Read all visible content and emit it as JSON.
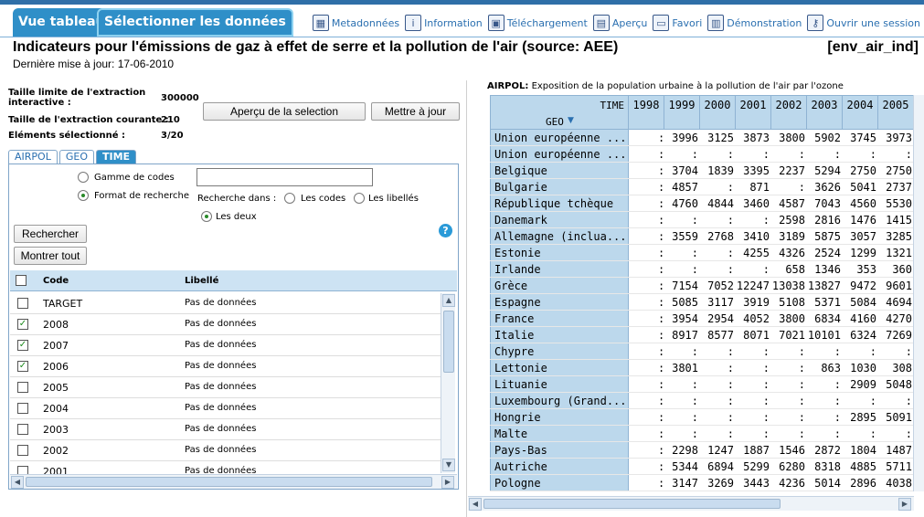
{
  "header": {
    "tabs": [
      "Vue tableau",
      "Sélectionner les données"
    ],
    "toolbar": [
      {
        "label": "Metadonnées",
        "icon": "metadata-icon"
      },
      {
        "label": "Information",
        "icon": "info-icon"
      },
      {
        "label": "Téléchargement",
        "icon": "save-icon"
      },
      {
        "label": "Aperçu",
        "icon": "print-icon"
      },
      {
        "label": "Favori",
        "icon": "folder-icon"
      },
      {
        "label": "Démonstration",
        "icon": "film-icon"
      },
      {
        "label": "Ouvrir une session",
        "icon": "key-icon"
      }
    ]
  },
  "page": {
    "title": "Indicateurs pour l'émissions de gaz à effet de serre et la pollution de l'air (source: AEE)",
    "code": "[env_air_ind]",
    "updated": "Dernière mise à jour: 17-06-2010"
  },
  "left": {
    "limit_label": "Taille limite de l'extraction interactive :",
    "limit_value": "300000",
    "current_label": "Taille de l'extraction courante :",
    "current_value": "210",
    "selected_label": "Eléments sélectionné :",
    "selected_value": "3/20",
    "preview_button": "Aperçu de la selection",
    "update_button": "Mettre à jour",
    "subtabs": [
      "AIRPOL",
      "GEO",
      "TIME"
    ],
    "radio_range": "Gamme de codes",
    "radio_format": "Format de recherche",
    "search_in": "Recherche dans :",
    "opt_codes": "Les codes",
    "opt_labels": "Les libellés",
    "opt_both": "Les deux",
    "search_button": "Rechercher",
    "show_all_button": "Montrer tout",
    "help": "?",
    "col_code": "Code",
    "col_label": "Libellé",
    "rows": [
      {
        "code": "TARGET",
        "label": "Pas de données",
        "checked": false
      },
      {
        "code": "2008",
        "label": "Pas de données",
        "checked": true
      },
      {
        "code": "2007",
        "label": "Pas de données",
        "checked": true
      },
      {
        "code": "2006",
        "label": "Pas de données",
        "checked": true
      },
      {
        "code": "2005",
        "label": "Pas de données",
        "checked": false
      },
      {
        "code": "2004",
        "label": "Pas de données",
        "checked": false
      },
      {
        "code": "2003",
        "label": "Pas de données",
        "checked": false
      },
      {
        "code": "2002",
        "label": "Pas de données",
        "checked": false
      },
      {
        "code": "2001",
        "label": "Pas de données",
        "checked": false
      }
    ]
  },
  "right": {
    "caption_code": "AIRPOL:",
    "caption_text": "Exposition de la population urbaine à la pollution de l'air par l'ozone",
    "time_label": "TIME",
    "geo_label": "GEO",
    "years": [
      "1998",
      "1999",
      "2000",
      "2001",
      "2002",
      "2003",
      "2004",
      "2005"
    ],
    "rows": [
      {
        "geo": "Union européenne ...",
        "vals": [
          ":",
          "3996",
          "3125",
          "3873",
          "3800",
          "5902",
          "3745",
          "3973"
        ]
      },
      {
        "geo": "Union européenne ...",
        "vals": [
          ":",
          ":",
          ":",
          ":",
          ":",
          ":",
          ":",
          ":"
        ]
      },
      {
        "geo": "Belgique",
        "vals": [
          ":",
          "3704",
          "1839",
          "3395",
          "2237",
          "5294",
          "2750",
          "2750"
        ]
      },
      {
        "geo": "Bulgarie",
        "vals": [
          ":",
          "4857",
          ":",
          "871",
          ":",
          "3626",
          "5041",
          "2737"
        ]
      },
      {
        "geo": "République tchèque",
        "vals": [
          ":",
          "4760",
          "4844",
          "3460",
          "4587",
          "7043",
          "4560",
          "5530"
        ]
      },
      {
        "geo": "Danemark",
        "vals": [
          ":",
          ":",
          ":",
          ":",
          "2598",
          "2816",
          "1476",
          "1415"
        ]
      },
      {
        "geo": "Allemagne (inclua...",
        "vals": [
          ":",
          "3559",
          "2768",
          "3410",
          "3189",
          "5875",
          "3057",
          "3285"
        ]
      },
      {
        "geo": "Estonie",
        "vals": [
          ":",
          ":",
          ":",
          "4255",
          "4326",
          "2524",
          "1299",
          "1321"
        ]
      },
      {
        "geo": "Irlande",
        "vals": [
          ":",
          ":",
          ":",
          ":",
          "658",
          "1346",
          "353",
          "360"
        ]
      },
      {
        "geo": "Grèce",
        "vals": [
          ":",
          "7154",
          "7052",
          "12247",
          "13038",
          "13827",
          "9472",
          "9601"
        ]
      },
      {
        "geo": "Espagne",
        "vals": [
          ":",
          "5085",
          "3117",
          "3919",
          "5108",
          "5371",
          "5084",
          "4694"
        ]
      },
      {
        "geo": "France",
        "vals": [
          ":",
          "3954",
          "2954",
          "4052",
          "3800",
          "6834",
          "4160",
          "4270"
        ]
      },
      {
        "geo": "Italie",
        "vals": [
          ":",
          "8917",
          "8577",
          "8071",
          "7021",
          "10101",
          "6324",
          "7269"
        ]
      },
      {
        "geo": "Chypre",
        "vals": [
          ":",
          ":",
          ":",
          ":",
          ":",
          ":",
          ":",
          ":"
        ]
      },
      {
        "geo": "Lettonie",
        "vals": [
          ":",
          "3801",
          ":",
          ":",
          ":",
          "863",
          "1030",
          "308"
        ]
      },
      {
        "geo": "Lituanie",
        "vals": [
          ":",
          ":",
          ":",
          ":",
          ":",
          ":",
          "2909",
          "5048"
        ]
      },
      {
        "geo": "Luxembourg (Grand...",
        "vals": [
          ":",
          ":",
          ":",
          ":",
          ":",
          ":",
          ":",
          ":"
        ]
      },
      {
        "geo": "Hongrie",
        "vals": [
          ":",
          ":",
          ":",
          ":",
          ":",
          ":",
          "2895",
          "5091"
        ]
      },
      {
        "geo": "Malte",
        "vals": [
          ":",
          ":",
          ":",
          ":",
          ":",
          ":",
          ":",
          ":"
        ]
      },
      {
        "geo": "Pays-Bas",
        "vals": [
          ":",
          "2298",
          "1247",
          "1887",
          "1546",
          "2872",
          "1804",
          "1487"
        ]
      },
      {
        "geo": "Autriche",
        "vals": [
          ":",
          "5344",
          "6894",
          "5299",
          "6280",
          "8318",
          "4885",
          "5711"
        ]
      },
      {
        "geo": "Pologne",
        "vals": [
          ":",
          "3147",
          "3269",
          "3443",
          "4236",
          "5014",
          "2896",
          "4038"
        ]
      }
    ]
  }
}
